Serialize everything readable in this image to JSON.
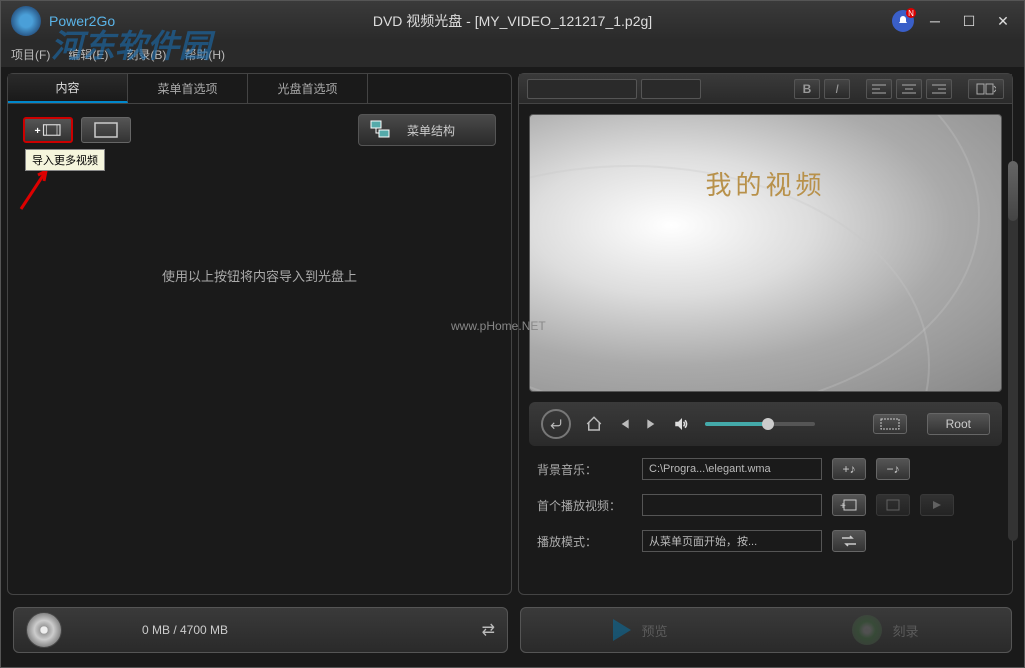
{
  "app": {
    "name": "Power2Go",
    "title": "DVD 视频光盘 - [MY_VIDEO_121217_1.p2g]"
  },
  "menubar": {
    "project": "项目(F)",
    "edit": "编辑(E)",
    "burn": "刻录(B)",
    "help": "帮助(H)"
  },
  "watermark": {
    "site": "河东软件园",
    "url": "www.pHome.NET"
  },
  "tabs": {
    "content": "内容",
    "menu_prefs": "菜单首选项",
    "disc_prefs": "光盘首选项"
  },
  "toolbar": {
    "import_tooltip": "导入更多视频",
    "menu_struct": "菜单结构"
  },
  "empty_hint": "使用以上按钮将内容导入到光盘上",
  "preview": {
    "title": "我的视频"
  },
  "playback": {
    "root": "Root"
  },
  "format": {
    "bold": "B",
    "italic": "I"
  },
  "settings": {
    "bg_music_label": "背景音乐：",
    "bg_music_value": "C:\\Progra...\\elegant.wma",
    "add_note": "+♪",
    "remove_note": "−♪",
    "first_play_label": "首个播放视频：",
    "play_mode_label": "播放模式：",
    "play_mode_value": "从菜单页面开始，按..."
  },
  "bottom": {
    "disc_usage": "0 MB / 4700 MB",
    "preview": "预览",
    "burn": "刻录"
  }
}
